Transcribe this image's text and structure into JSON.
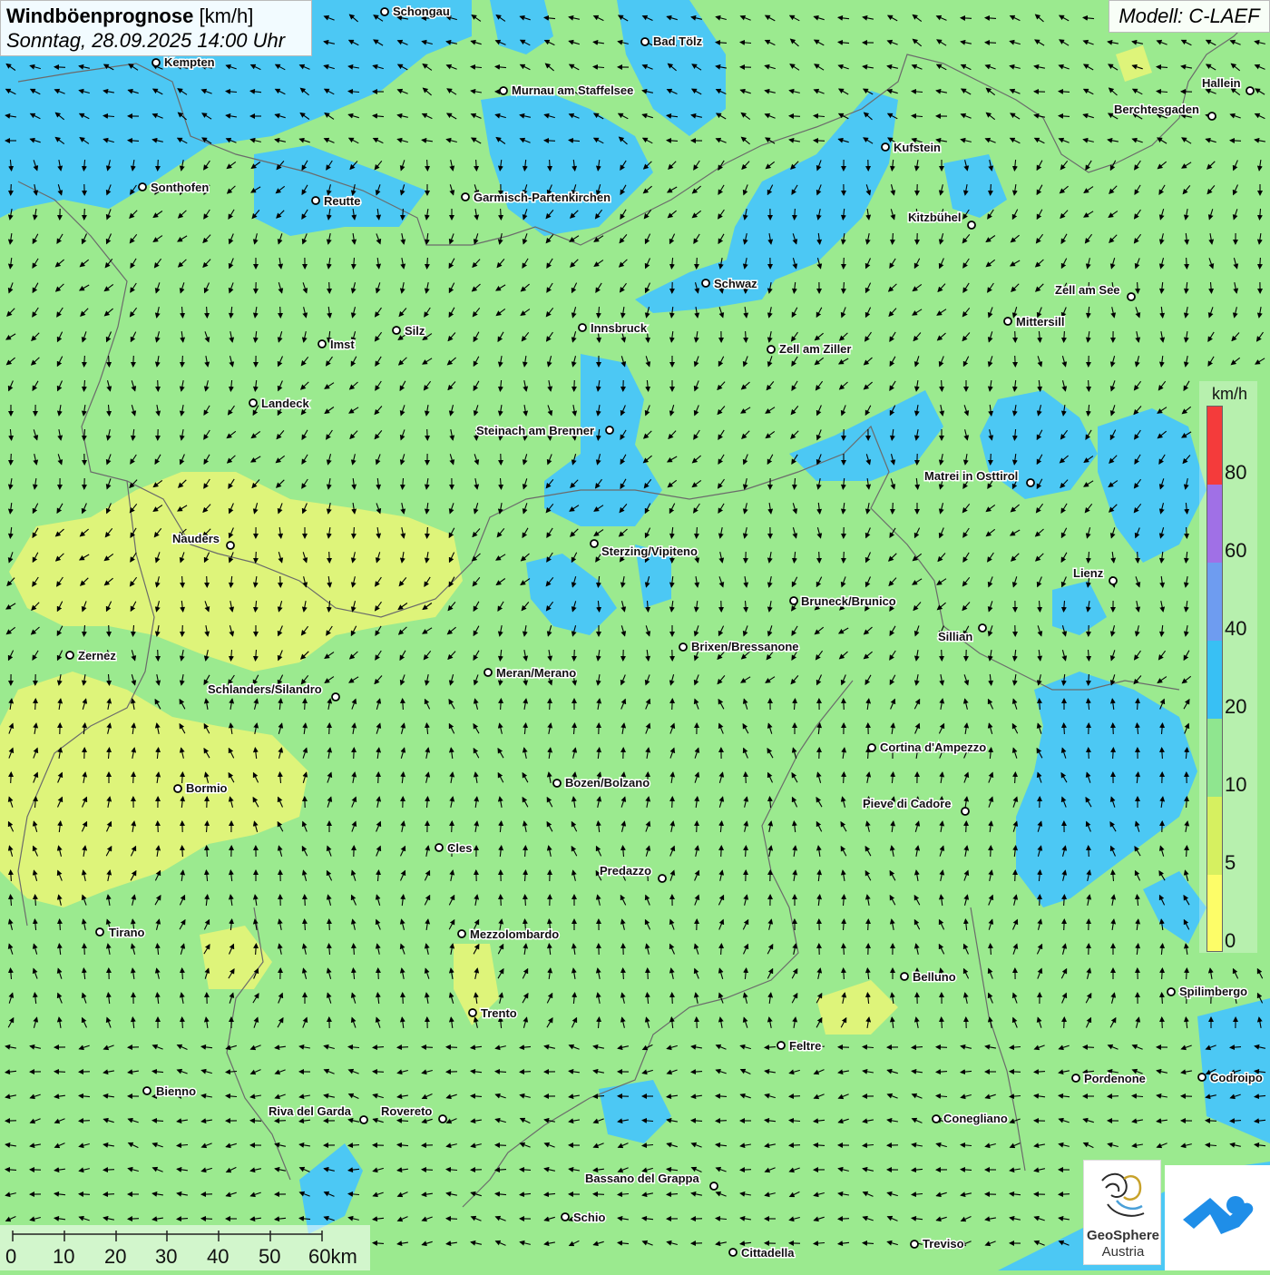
{
  "header": {
    "title_bold": "Windböenprognose",
    "title_unit": "[km/h]",
    "datetime": "Sonntag, 28.09.2025 14:00 Uhr"
  },
  "model": {
    "label": "Modell: C-LAEF"
  },
  "legend": {
    "unit": "km/h",
    "labels": [
      "80",
      "60",
      "40",
      "20",
      "10",
      "5",
      "0"
    ],
    "colors": [
      "#f43b3b",
      "#a070e6",
      "#6e9cf0",
      "#38c0f4",
      "#8fe68f",
      "#d6f060",
      "#fdfd68"
    ]
  },
  "scale_bar": {
    "labels": [
      "0",
      "10",
      "20",
      "30",
      "40",
      "50",
      "60km"
    ]
  },
  "logos": {
    "geosphere_line1": "GeoSphere",
    "geosphere_line2": "Austria"
  },
  "colors": {
    "calm": "#9bea8f",
    "light": "#def47a",
    "moderate": "#4cc8f4"
  },
  "cities": [
    {
      "name": "Schongau"
    },
    {
      "name": "Bad Tölz"
    },
    {
      "name": "Kempten"
    },
    {
      "name": "Murnau am Staffelsee"
    },
    {
      "name": "Hallein"
    },
    {
      "name": "Berchtesgaden"
    },
    {
      "name": "Kufstein"
    },
    {
      "name": "Sonthofen"
    },
    {
      "name": "Reutte"
    },
    {
      "name": "Garmisch-Partenkirchen"
    },
    {
      "name": "Kitzbühel"
    },
    {
      "name": "Schwaz"
    },
    {
      "name": "Zell am See"
    },
    {
      "name": "Mittersill"
    },
    {
      "name": "Innsbruck"
    },
    {
      "name": "Silz"
    },
    {
      "name": "Imst"
    },
    {
      "name": "Zell am Ziller"
    },
    {
      "name": "Landeck"
    },
    {
      "name": "Steinach am Brenner"
    },
    {
      "name": "Matrei in Osttirol"
    },
    {
      "name": "Nauders"
    },
    {
      "name": "Sterzing/Vipiteno"
    },
    {
      "name": "Lienz"
    },
    {
      "name": "Bruneck/Brunico"
    },
    {
      "name": "Sillian"
    },
    {
      "name": "Brixen/Bressanone"
    },
    {
      "name": "Zernez"
    },
    {
      "name": "Meran/Merano"
    },
    {
      "name": "Schlanders/Silandro"
    },
    {
      "name": "Cortina d'Ampezzo"
    },
    {
      "name": "Bozen/Bolzano"
    },
    {
      "name": "Bormio"
    },
    {
      "name": "Pieve di Cadore"
    },
    {
      "name": "Cles"
    },
    {
      "name": "Predazzo"
    },
    {
      "name": "Tirano"
    },
    {
      "name": "Mezzolombardo"
    },
    {
      "name": "Belluno"
    },
    {
      "name": "Spilimbergo"
    },
    {
      "name": "Trento"
    },
    {
      "name": "Feltre"
    },
    {
      "name": "Pordenone"
    },
    {
      "name": "Codroipo"
    },
    {
      "name": "Bienno"
    },
    {
      "name": "Riva del Garda"
    },
    {
      "name": "Rovereto"
    },
    {
      "name": "Conegliano"
    },
    {
      "name": "Bassano del Grappa"
    },
    {
      "name": "Schio"
    },
    {
      "name": "Treviso"
    },
    {
      "name": "Cittadella"
    }
  ]
}
